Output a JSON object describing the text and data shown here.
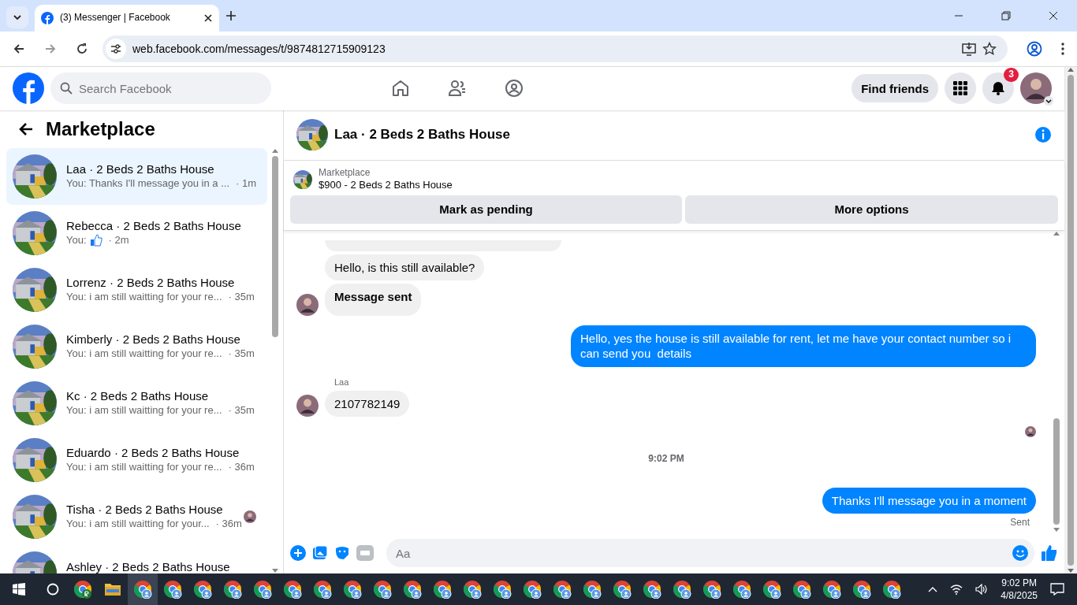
{
  "browser": {
    "tab_title": "(3) Messenger | Facebook",
    "url": "web.facebook.com/messages/t/9874812715909123"
  },
  "header": {
    "search_placeholder": "Search Facebook",
    "find_friends": "Find friends",
    "notification_count": "3"
  },
  "sidebar": {
    "title": "Marketplace",
    "conversations": [
      {
        "name": "Laa · 2 Beds 2 Baths House",
        "preview": "You: Thanks I'll message you in a ...",
        "time": "· 1m",
        "kind": "text",
        "selected": true,
        "seen": false
      },
      {
        "name": "Rebecca · 2 Beds 2 Baths House",
        "preview": "You:",
        "time": "· 2m",
        "kind": "like",
        "selected": false,
        "seen": false
      },
      {
        "name": "Lorrenz · 2 Beds 2 Baths House",
        "preview": "You: i am still waitting for your re...",
        "time": "· 35m",
        "kind": "text",
        "selected": false,
        "seen": false
      },
      {
        "name": "Kimberly · 2 Beds 2 Baths House",
        "preview": "You: i am still waitting for your re...",
        "time": "· 35m",
        "kind": "text",
        "selected": false,
        "seen": false
      },
      {
        "name": "Kc · 2 Beds 2 Baths House",
        "preview": "You: i am still waitting for your re...",
        "time": "· 35m",
        "kind": "text",
        "selected": false,
        "seen": false
      },
      {
        "name": "Eduardo · 2 Beds 2 Baths House",
        "preview": "You: i am still waitting for your re...",
        "time": "· 36m",
        "kind": "text",
        "selected": false,
        "seen": false
      },
      {
        "name": "Tisha · 2 Beds 2 Baths House",
        "preview": "You: i am still waitting for your...",
        "time": "· 36m",
        "kind": "text",
        "selected": false,
        "seen": true
      },
      {
        "name": "Ashley · 2 Beds 2 Baths House",
        "kind": "text",
        "selected": false,
        "seen": false
      }
    ]
  },
  "chat": {
    "title": "Laa · 2 Beds 2 Baths House",
    "listing_label": "Marketplace",
    "listing_title": "$900 - 2 Beds 2 Baths House",
    "actions": [
      "Mark as pending",
      "More options"
    ],
    "messages": [
      {
        "kind": "incoming",
        "text": "Hello, is this still available?",
        "bold": false,
        "avatar": false
      },
      {
        "kind": "incoming",
        "text": "Message sent",
        "bold": true,
        "avatar": true
      },
      {
        "kind": "outgoing",
        "text": "Hello, yes the house is still available for rent, let me have your contact number so i can send you  details"
      },
      {
        "kind": "sender",
        "text": "Laa"
      },
      {
        "kind": "incoming",
        "text": "2107782149",
        "bold": false,
        "avatar": true
      },
      {
        "kind": "seen"
      },
      {
        "kind": "time",
        "text": "9:02 PM"
      },
      {
        "kind": "outgoing",
        "text": "Thanks I'll message you in a moment"
      },
      {
        "kind": "status",
        "text": "Sent"
      }
    ],
    "composer_placeholder": "Aa"
  },
  "taskbar": {
    "apps": [
      {
        "kind": "chrome-r",
        "selected": false
      },
      {
        "kind": "folder",
        "selected": false
      },
      {
        "kind": "chrome",
        "selected": true
      },
      {
        "kind": "chrome",
        "selected": false
      },
      {
        "kind": "chrome",
        "selected": false
      },
      {
        "kind": "chrome",
        "selected": false
      },
      {
        "kind": "chrome",
        "selected": false
      },
      {
        "kind": "chrome",
        "selected": false
      },
      {
        "kind": "chrome",
        "selected": false
      },
      {
        "kind": "chrome",
        "selected": false
      },
      {
        "kind": "chrome",
        "selected": false
      },
      {
        "kind": "chrome",
        "selected": false
      },
      {
        "kind": "chrome",
        "selected": false
      },
      {
        "kind": "chrome",
        "selected": false
      },
      {
        "kind": "chrome",
        "selected": false
      },
      {
        "kind": "chrome",
        "selected": false
      },
      {
        "kind": "chrome",
        "selected": false
      },
      {
        "kind": "chrome",
        "selected": false
      },
      {
        "kind": "chrome",
        "selected": false
      },
      {
        "kind": "chrome",
        "selected": false
      },
      {
        "kind": "chrome",
        "selected": false
      },
      {
        "kind": "chrome",
        "selected": false
      },
      {
        "kind": "chrome",
        "selected": false
      },
      {
        "kind": "chrome",
        "selected": false
      },
      {
        "kind": "chrome",
        "selected": false
      },
      {
        "kind": "chrome",
        "selected": false
      },
      {
        "kind": "chrome",
        "selected": false
      },
      {
        "kind": "chrome",
        "selected": false
      }
    ],
    "time": "9:02 PM",
    "date": "4/8/2025"
  }
}
